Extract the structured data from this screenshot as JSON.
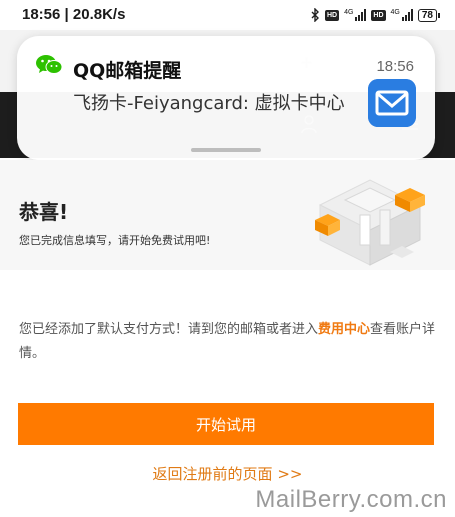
{
  "status_bar": {
    "time_speed": "18:56 | 20.8K/s",
    "hd_label": "HD",
    "network_label": "4G",
    "battery": "78"
  },
  "notification": {
    "app_name": "QQ邮箱提醒",
    "time": "18:56",
    "body": "飞扬卡-Feiyangcard: 虚拟卡中心",
    "icons": {
      "app": "wechat-icon",
      "mail": "mail-icon"
    },
    "colors": {
      "mail_bg": "#2a7de1"
    }
  },
  "banner": {
    "title": "恭喜!",
    "subtitle": "您已完成信息填写，请开始免费试用吧!"
  },
  "content": {
    "info_before": "您已经添加了默认支付方式！请到您的邮箱或者进入",
    "info_link": "费用中心",
    "info_after": "查看账户详情。",
    "start_button": "开始试用",
    "back_link": "返回注册前的页面 >>"
  },
  "watermark": "MailBerry.com.cn",
  "colors": {
    "accent": "#ff7a00",
    "link": "#e07b16"
  }
}
